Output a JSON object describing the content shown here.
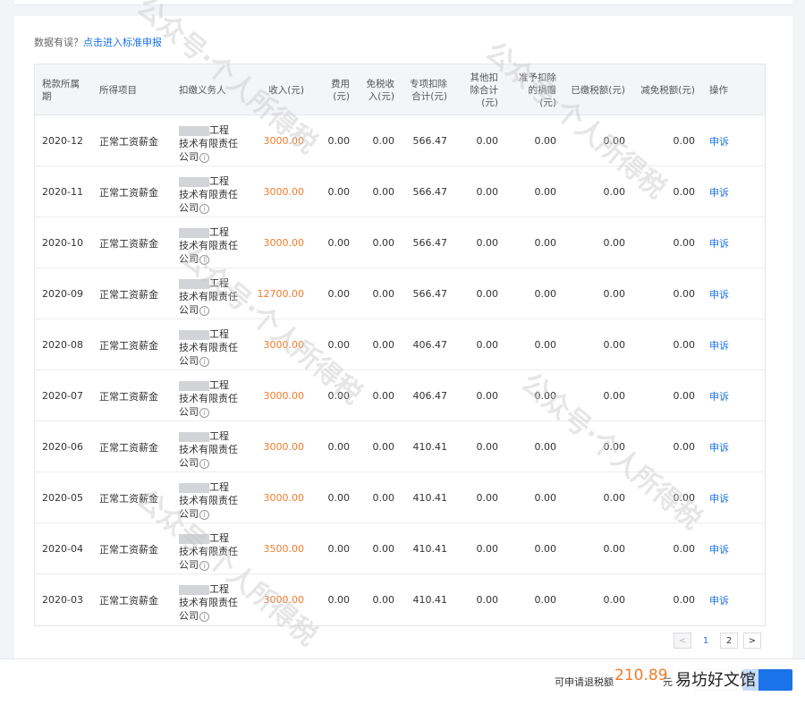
{
  "notice": {
    "prefix": "数据有误？",
    "link": "点击进入标准申报"
  },
  "table": {
    "headers": {
      "period": "税款所属期",
      "item": "所得项目",
      "withholder": "扣缴义务人",
      "income": "收入(元)",
      "expense": "费用(元)",
      "taxfree": "免税收入(元)",
      "special": "专项扣除合计(元)",
      "other": "其他扣除合计(元)",
      "donation": "准予扣除的捐赠(元)",
      "paid": "已缴税额(元)",
      "reduced": "减免税额(元)",
      "action": "操作"
    },
    "rows": [
      {
        "period": "2020-12",
        "item": "正常工资薪金",
        "company_1": "工程",
        "company_2": "技术有限责任",
        "company_3": "公司",
        "income": "3000.00",
        "expense": "0.00",
        "taxfree": "0.00",
        "special": "566.47",
        "other": "0.00",
        "donation": "0.00",
        "paid": "0.00",
        "reduced": "0.00",
        "action": "申诉"
      },
      {
        "period": "2020-11",
        "item": "正常工资薪金",
        "company_1": "工程",
        "company_2": "技术有限责任",
        "company_3": "公司",
        "income": "3000.00",
        "expense": "0.00",
        "taxfree": "0.00",
        "special": "566.47",
        "other": "0.00",
        "donation": "0.00",
        "paid": "0.00",
        "reduced": "0.00",
        "action": "申诉"
      },
      {
        "period": "2020-10",
        "item": "正常工资薪金",
        "company_1": "工程",
        "company_2": "技术有限责任",
        "company_3": "公司",
        "income": "3000.00",
        "expense": "0.00",
        "taxfree": "0.00",
        "special": "566.47",
        "other": "0.00",
        "donation": "0.00",
        "paid": "0.00",
        "reduced": "0.00",
        "action": "申诉"
      },
      {
        "period": "2020-09",
        "item": "正常工资薪金",
        "company_1": "工程",
        "company_2": "技术有限责任",
        "company_3": "公司",
        "income": "12700.00",
        "expense": "0.00",
        "taxfree": "0.00",
        "special": "566.47",
        "other": "0.00",
        "donation": "0.00",
        "paid": "0.00",
        "reduced": "0.00",
        "action": "申诉"
      },
      {
        "period": "2020-08",
        "item": "正常工资薪金",
        "company_1": "工程",
        "company_2": "技术有限责任",
        "company_3": "公司",
        "income": "3000.00",
        "expense": "0.00",
        "taxfree": "0.00",
        "special": "406.47",
        "other": "0.00",
        "donation": "0.00",
        "paid": "0.00",
        "reduced": "0.00",
        "action": "申诉"
      },
      {
        "period": "2020-07",
        "item": "正常工资薪金",
        "company_1": "工程",
        "company_2": "技术有限责任",
        "company_3": "公司",
        "income": "3000.00",
        "expense": "0.00",
        "taxfree": "0.00",
        "special": "406.47",
        "other": "0.00",
        "donation": "0.00",
        "paid": "0.00",
        "reduced": "0.00",
        "action": "申诉"
      },
      {
        "period": "2020-06",
        "item": "正常工资薪金",
        "company_1": "工程",
        "company_2": "技术有限责任",
        "company_3": "公司",
        "income": "3000.00",
        "expense": "0.00",
        "taxfree": "0.00",
        "special": "410.41",
        "other": "0.00",
        "donation": "0.00",
        "paid": "0.00",
        "reduced": "0.00",
        "action": "申诉"
      },
      {
        "period": "2020-05",
        "item": "正常工资薪金",
        "company_1": "工程",
        "company_2": "技术有限责任",
        "company_3": "公司",
        "income": "3000.00",
        "expense": "0.00",
        "taxfree": "0.00",
        "special": "410.41",
        "other": "0.00",
        "donation": "0.00",
        "paid": "0.00",
        "reduced": "0.00",
        "action": "申诉"
      },
      {
        "period": "2020-04",
        "item": "正常工资薪金",
        "company_1": "工程",
        "company_2": "技术有限责任",
        "company_3": "公司",
        "income": "3500.00",
        "expense": "0.00",
        "taxfree": "0.00",
        "special": "410.41",
        "other": "0.00",
        "donation": "0.00",
        "paid": "0.00",
        "reduced": "0.00",
        "action": "申诉"
      },
      {
        "period": "2020-03",
        "item": "正常工资薪金",
        "company_1": "工程",
        "company_2": "技术有限责任",
        "company_3": "公司",
        "income": "3000.00",
        "expense": "0.00",
        "taxfree": "0.00",
        "special": "410.41",
        "other": "0.00",
        "donation": "0.00",
        "paid": "0.00",
        "reduced": "0.00",
        "action": "申诉"
      }
    ]
  },
  "pagination": {
    "prev": "<",
    "pages": [
      "1",
      "2"
    ],
    "next": ">",
    "current": "1"
  },
  "footer": {
    "refund_label": "可申请退税额",
    "refund_amount": "210.89",
    "refund_unit": "元"
  },
  "watermark": {
    "text": "公众号·个人所得税",
    "brand": "易坊好文馆"
  },
  "colors": {
    "accent": "#1a73e8",
    "income": "#f07c2c"
  }
}
